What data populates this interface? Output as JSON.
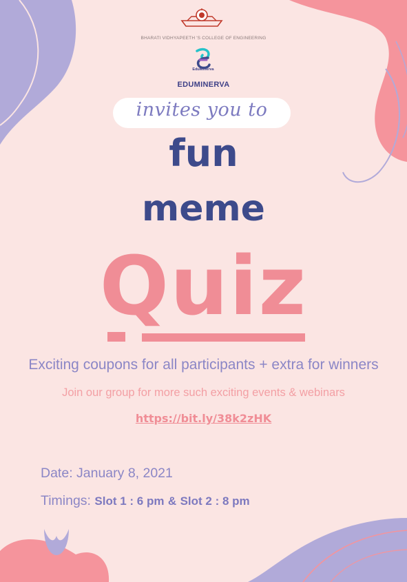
{
  "colors": {
    "background": "#fbe5e3",
    "lavender": "#b1aad9",
    "pink": "#f08d96",
    "navy": "#3d4a8b",
    "text_lavender": "#8b86c6"
  },
  "header": {
    "college_name": "BHARATI VIDHYAPEETH 'S COLLEGE OF ENGINEERING",
    "edu_logo_caption": "EduMinerva",
    "org_name": "EDUMINERVA"
  },
  "title": {
    "invite": "invites you to",
    "line1": "fun",
    "line2": "meme",
    "line3": "Quiz"
  },
  "details": {
    "benefits": "Exciting coupons for all participants + extra for winners",
    "join": "Join our group for more such exciting events & webinars",
    "link": "https://bit.ly/38k2zHK",
    "date": "Date: January 8, 2021",
    "timings_label": "Timings:",
    "slot1": "Slot 1 : 6 pm",
    "slot_sep": "&",
    "slot2": "Slot 2 : 8 pm"
  }
}
